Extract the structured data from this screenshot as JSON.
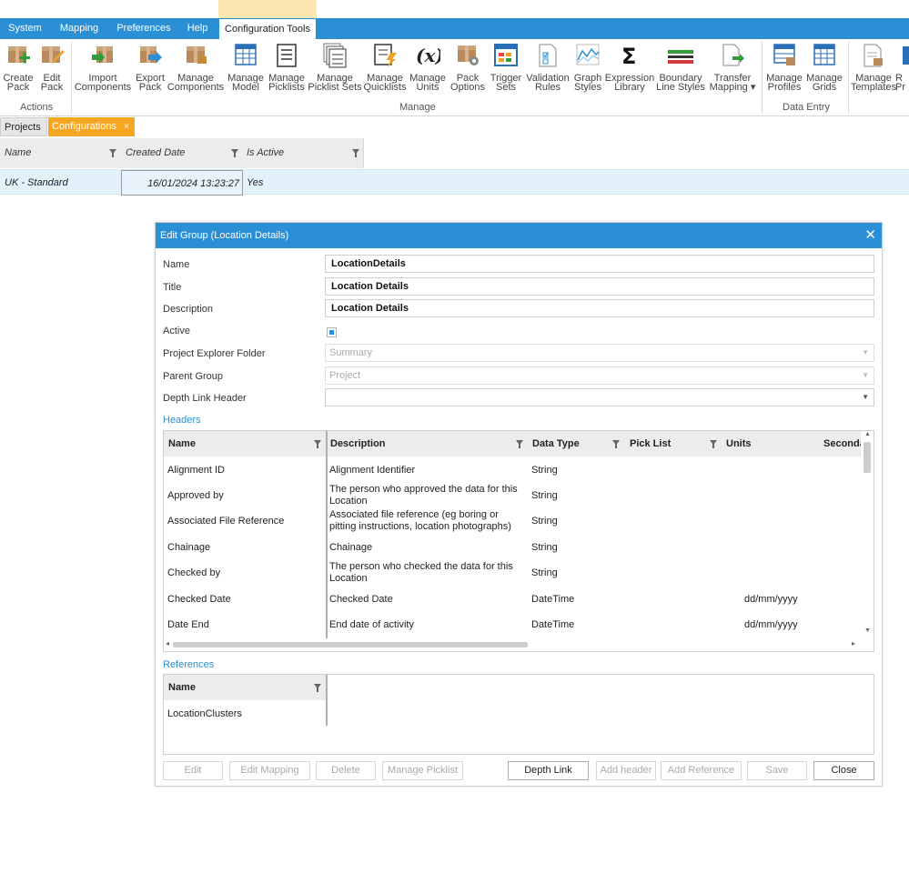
{
  "menu": {
    "items": [
      "System",
      "Mapping",
      "Preferences",
      "Help",
      "Configuration Tools"
    ],
    "active": "Configuration Tools"
  },
  "ribbon": {
    "groups": {
      "actions": "Actions",
      "manage": "Manage",
      "data_entry": "Data Entry"
    },
    "buttons": {
      "create_pack": [
        "Create",
        "Pack"
      ],
      "edit_pack": [
        "Edit",
        "Pack"
      ],
      "import_components": [
        "Import",
        "Components"
      ],
      "export_pack": [
        "Export",
        "Pack"
      ],
      "manage_components": [
        "Manage",
        "Components"
      ],
      "manage_model": [
        "Manage",
        "Model"
      ],
      "manage_picklists": [
        "Manage",
        "Picklists"
      ],
      "manage_picklist_sets": [
        "Manage",
        "Picklist Sets"
      ],
      "manage_quicklists": [
        "Manage",
        "Quicklists"
      ],
      "manage_units": [
        "Manage",
        "Units"
      ],
      "pack_options": [
        "Pack",
        "Options"
      ],
      "trigger_sets": [
        "Trigger",
        "Sets"
      ],
      "validation_rules": [
        "Validation",
        "Rules"
      ],
      "graph_styles": [
        "Graph",
        "Styles"
      ],
      "expression_library": [
        "Expression",
        "Library"
      ],
      "boundary_line_styles": [
        "Boundary",
        "Line Styles"
      ],
      "transfer_mapping": [
        "Transfer",
        "Mapping ▾"
      ],
      "manage_profiles": [
        "Manage",
        "Profiles"
      ],
      "manage_grids": [
        "Manage",
        "Grids"
      ],
      "manage_templates": [
        "Manage",
        "Templates"
      ],
      "cut_off": [
        "R",
        "Pr"
      ]
    }
  },
  "doc_tabs": {
    "projects": "Projects",
    "configurations": "Configurations",
    "close_glyph": "×"
  },
  "config_grid": {
    "columns": [
      "Name",
      "Created Date",
      "Is Active"
    ],
    "rows": [
      {
        "name": "UK - Standard",
        "created": "16/01/2024 13:23:27",
        "active": "Yes"
      }
    ]
  },
  "dialog": {
    "title": "Edit Group (Location Details)",
    "close_glyph": "✕",
    "fields": {
      "name_label": "Name",
      "name_value": "LocationDetails",
      "title_label": "Title",
      "title_value": "Location Details",
      "description_label": "Description",
      "description_value": "Location Details",
      "active_label": "Active",
      "active_checked": true,
      "folder_label": "Project Explorer Folder",
      "folder_value": "Summary",
      "parent_label": "Parent Group",
      "parent_value": "Project",
      "depth_label": "Depth Link Header",
      "depth_value": ""
    },
    "headers_label": "Headers",
    "headers_columns": [
      "Name",
      "Description",
      "Data Type",
      "Pick List",
      "Units",
      "Seconda"
    ],
    "headers_rows": [
      {
        "name": "Alignment ID",
        "description": "Alignment Identifier",
        "type": "String",
        "picklist": "",
        "units": ""
      },
      {
        "name": "Approved by",
        "description": "The person who approved the data for this Location",
        "type": "String",
        "picklist": "",
        "units": ""
      },
      {
        "name": "Associated File Reference",
        "description": "Associated file reference (eg boring or pitting instructions, location photographs)",
        "type": "String",
        "picklist": "",
        "units": ""
      },
      {
        "name": "Chainage",
        "description": "Chainage",
        "type": "String",
        "picklist": "",
        "units": ""
      },
      {
        "name": "Checked by",
        "description": "The person who checked the data for this Location",
        "type": "String",
        "picklist": "",
        "units": ""
      },
      {
        "name": "Checked Date",
        "description": "Checked Date",
        "type": "DateTime",
        "picklist": "",
        "units": "dd/mm/yyyy"
      },
      {
        "name": "Date End",
        "description": "End date of activity",
        "type": "DateTime",
        "picklist": "",
        "units": "dd/mm/yyyy"
      }
    ],
    "references_label": "References",
    "references_columns": [
      "Name"
    ],
    "references_rows": [
      "LocationClusters"
    ],
    "buttons": {
      "edit": "Edit",
      "edit_mapping": "Edit Mapping",
      "delete": "Delete",
      "manage_picklist": "Manage Picklist",
      "depth_link": "Depth Link",
      "add_header": "Add header",
      "add_reference": "Add Reference",
      "save": "Save",
      "close": "Close"
    }
  },
  "colors": {
    "accent_blue": "#2b8fd6",
    "tab_orange": "#f5a623",
    "selection": "#e3f1fb"
  }
}
